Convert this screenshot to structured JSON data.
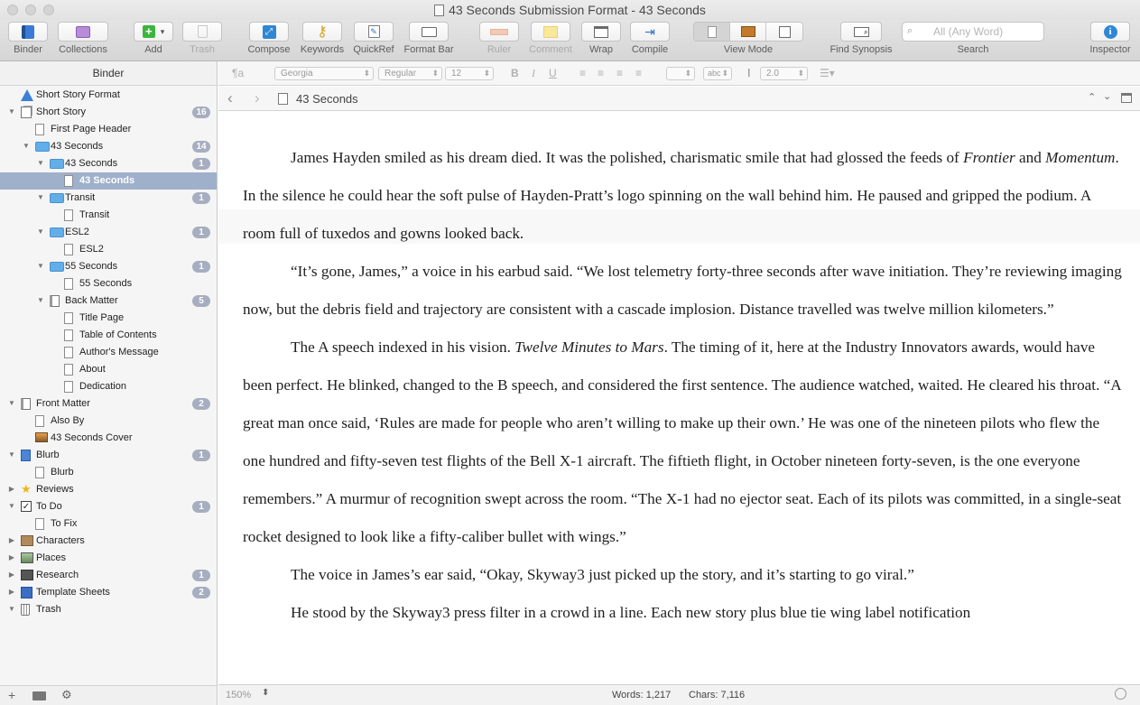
{
  "window": {
    "title": "43 Seconds Submission Format - 43 Seconds"
  },
  "toolbar": {
    "binder": "Binder",
    "collections": "Collections",
    "add": "Add",
    "trash": "Trash",
    "compose": "Compose",
    "keywords": "Keywords",
    "quickref": "QuickRef",
    "format_bar": "Format Bar",
    "ruler": "Ruler",
    "comment": "Comment",
    "wrap": "Wrap",
    "compile": "Compile",
    "view_mode": "View Mode",
    "find_synopsis": "Find Synopsis",
    "search": "Search",
    "search_placeholder": "All (Any Word)",
    "inspector": "Inspector"
  },
  "binder": {
    "header": "Binder",
    "items": [
      {
        "label": "Short Story Format",
        "depth": 0,
        "icon": "warning-icon",
        "disclosure": "none",
        "badge": ""
      },
      {
        "label": "Short Story",
        "depth": 0,
        "icon": "manuscript-icon",
        "disclosure": "open",
        "badge": "16"
      },
      {
        "label": "First Page Header",
        "depth": 1,
        "icon": "document-icon",
        "disclosure": "none",
        "badge": ""
      },
      {
        "label": "43 Seconds",
        "depth": 1,
        "icon": "folder-icon",
        "disclosure": "open",
        "badge": "14"
      },
      {
        "label": "43 Seconds",
        "depth": 2,
        "icon": "folder-icon",
        "disclosure": "open",
        "badge": "1"
      },
      {
        "label": "43 Seconds",
        "depth": 3,
        "icon": "document-icon",
        "disclosure": "none",
        "badge": "",
        "selected": true
      },
      {
        "label": "Transit",
        "depth": 2,
        "icon": "folder-icon",
        "disclosure": "open",
        "badge": "1"
      },
      {
        "label": "Transit",
        "depth": 3,
        "icon": "document-icon",
        "disclosure": "none",
        "badge": ""
      },
      {
        "label": "ESL2",
        "depth": 2,
        "icon": "folder-icon",
        "disclosure": "open",
        "badge": "1"
      },
      {
        "label": "ESL2",
        "depth": 3,
        "icon": "document-icon",
        "disclosure": "none",
        "badge": ""
      },
      {
        "label": "55 Seconds",
        "depth": 2,
        "icon": "folder-icon",
        "disclosure": "open",
        "badge": "1"
      },
      {
        "label": "55 Seconds",
        "depth": 3,
        "icon": "document-icon",
        "disclosure": "none",
        "badge": ""
      },
      {
        "label": "Back Matter",
        "depth": 2,
        "icon": "book-icon",
        "disclosure": "open",
        "badge": "5"
      },
      {
        "label": "Title Page",
        "depth": 3,
        "icon": "document-icon",
        "disclosure": "none",
        "badge": ""
      },
      {
        "label": "Table of Contents",
        "depth": 3,
        "icon": "document-icon",
        "disclosure": "none",
        "badge": ""
      },
      {
        "label": "Author's Message",
        "depth": 3,
        "icon": "document-icon",
        "disclosure": "none",
        "badge": ""
      },
      {
        "label": "About",
        "depth": 3,
        "icon": "document-icon",
        "disclosure": "none",
        "badge": ""
      },
      {
        "label": "Dedication",
        "depth": 3,
        "icon": "document-icon",
        "disclosure": "none",
        "badge": ""
      },
      {
        "label": "Front Matter",
        "depth": 0,
        "icon": "book-icon",
        "disclosure": "open",
        "badge": "2"
      },
      {
        "label": "Also By",
        "depth": 1,
        "icon": "blank-document-icon",
        "disclosure": "none",
        "badge": ""
      },
      {
        "label": "43 Seconds Cover",
        "depth": 1,
        "icon": "image-icon",
        "disclosure": "none",
        "badge": ""
      },
      {
        "label": "Blurb",
        "depth": 0,
        "icon": "notebook-icon",
        "disclosure": "open",
        "badge": "1"
      },
      {
        "label": "Blurb",
        "depth": 1,
        "icon": "document-icon",
        "disclosure": "none",
        "badge": ""
      },
      {
        "label": "Reviews",
        "depth": 0,
        "icon": "star-icon",
        "disclosure": "closed",
        "badge": ""
      },
      {
        "label": "To Do",
        "depth": 0,
        "icon": "checkbox-icon",
        "disclosure": "open",
        "badge": "1"
      },
      {
        "label": "To Fix",
        "depth": 1,
        "icon": "document-icon",
        "disclosure": "none",
        "badge": ""
      },
      {
        "label": "Characters",
        "depth": 0,
        "icon": "character-icon",
        "disclosure": "closed",
        "badge": ""
      },
      {
        "label": "Places",
        "depth": 0,
        "icon": "picture-icon",
        "disclosure": "closed",
        "badge": ""
      },
      {
        "label": "Research",
        "depth": 0,
        "icon": "research-icon",
        "disclosure": "closed",
        "badge": "1"
      },
      {
        "label": "Template Sheets",
        "depth": 0,
        "icon": "template-icon",
        "disclosure": "closed",
        "badge": "2"
      },
      {
        "label": "Trash",
        "depth": 0,
        "icon": "trash-icon",
        "disclosure": "open",
        "badge": ""
      }
    ]
  },
  "formatbar": {
    "style_glyph": "¶a",
    "font": "Georgia",
    "weight": "Regular",
    "size": "12",
    "bold": "B",
    "italic": "I",
    "underline": "U",
    "highlight": "abc",
    "line_spacing": "2.0"
  },
  "editor": {
    "doc_title": "43 Seconds",
    "paragraphs": [
      [
        {
          "t": "James Hayden smiled as his dream died. It was the polished, charismatic smile that had glossed the feeds of "
        },
        {
          "t": "Frontier",
          "i": true
        },
        {
          "t": " and "
        },
        {
          "t": "Momentum",
          "i": true
        },
        {
          "t": ". In the silence he could hear the soft pulse of Hayden-Pratt’s logo spinning on the wall behind him. He paused and gripped the podium. A room full of tuxedos and gowns looked back."
        }
      ],
      [
        {
          "t": "“It’s gone, James,” a voice in his earbud said. “We lost telemetry forty-three seconds after wave initiation. They’re reviewing imaging now, but the debris field and trajectory are consistent with a cascade implosion. Distance travelled was twelve million kilometers.”"
        }
      ],
      [
        {
          "t": "The A speech indexed in his vision. "
        },
        {
          "t": "Twelve Minutes to Mars",
          "i": true
        },
        {
          "t": ". The timing of it, here at the Industry Innovators awards, would have been perfect. He blinked, changed to the B speech, and considered the first sentence. The audience watched, waited. He cleared his throat. “A great man once said, ‘Rules are made for people who aren’t willing to make up their own.’ He was one of the nineteen pilots who flew the one hundred and fifty-seven test flights of the Bell X-1 aircraft. The fiftieth flight, in October nineteen forty-seven, is the one everyone remembers.” A murmur of recognition swept across the room. “The X-1 had no ejector seat. Each of its pilots was committed, in a single-seat rocket designed to look like a fifty-caliber bullet with wings.”"
        }
      ],
      [
        {
          "t": "The voice in James’s ear said, “Okay, Skyway3 just picked up the story, and it’s starting to go viral.”"
        }
      ],
      [
        {
          "t": "He stood by the Skyway3 press filter in a crowd in a line. Each new story plus blue tie wing label notification"
        }
      ]
    ]
  },
  "statusbar": {
    "zoom": "150%",
    "words": "Words: 1,217",
    "chars": "Chars: 7,116"
  }
}
